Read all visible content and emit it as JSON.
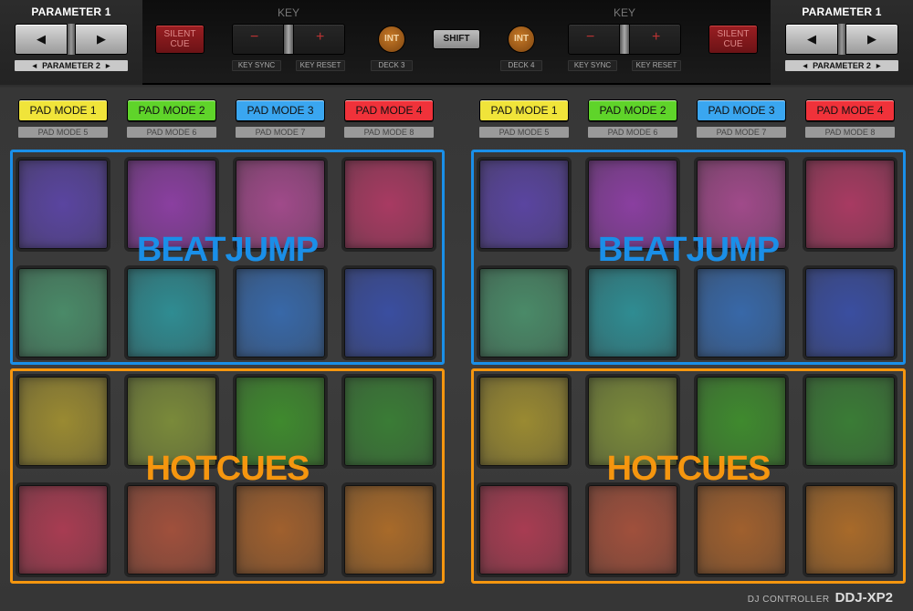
{
  "header": {
    "left_param": {
      "title": "PARAMETER 1",
      "sub_label": "PARAMETER 2",
      "left_arrow": "◀",
      "right_arrow": "▶"
    },
    "right_param": {
      "title": "PARAMETER 1",
      "sub_label": "PARAMETER 2",
      "left_arrow": "◀",
      "right_arrow": "▶"
    },
    "left_deck": {
      "silent_cue": "SILENT CUE",
      "key_title": "KEY",
      "minus": "−",
      "plus": "+",
      "key_sync": "KEY SYNC",
      "key_reset": "KEY RESET",
      "int_label": "INT",
      "deck_label": "DECK 3"
    },
    "shift_label": "SHIFT",
    "right_deck": {
      "int_label": "INT",
      "deck_label": "DECK 4",
      "key_title": "KEY",
      "minus": "−",
      "plus": "+",
      "key_sync": "KEY SYNC",
      "key_reset": "KEY RESET",
      "silent_cue": "SILENT CUE"
    }
  },
  "pad_modes": {
    "left": [
      {
        "label": "PAD MODE 1",
        "sub": "PAD MODE 5",
        "color": "#f0e43a"
      },
      {
        "label": "PAD MODE 2",
        "sub": "PAD MODE 6",
        "color": "#5fd42a"
      },
      {
        "label": "PAD MODE 3",
        "sub": "PAD MODE 7",
        "color": "#3aa6f0"
      },
      {
        "label": "PAD MODE 4",
        "sub": "PAD MODE 8",
        "color": "#f0323a"
      }
    ],
    "right": [
      {
        "label": "PAD MODE 1",
        "sub": "PAD MODE 5",
        "color": "#f0e43a"
      },
      {
        "label": "PAD MODE 2",
        "sub": "PAD MODE 6",
        "color": "#5fd42a"
      },
      {
        "label": "PAD MODE 3",
        "sub": "PAD MODE 7",
        "color": "#3aa6f0"
      },
      {
        "label": "PAD MODE 4",
        "sub": "PAD MODE 8",
        "color": "#f0323a"
      }
    ]
  },
  "zones": {
    "top": {
      "label": "BEATJUMP",
      "color": "#1a8fe8"
    },
    "bottom": {
      "label": "HOTCUES",
      "color": "#f5960f"
    }
  },
  "pad_colors": [
    "#5a45a0",
    "#8a3fa0",
    "#a04a8a",
    "#a83a62",
    "#4a8a68",
    "#2f8c92",
    "#3868a8",
    "#3a4ea0",
    "#9a8a32",
    "#7a8a3a",
    "#3f8a2e",
    "#3a7c36",
    "#a83c52",
    "#a0503c",
    "#a0602e",
    "#a86a2a"
  ],
  "footer": {
    "model_prefix": "DJ CONTROLLER",
    "model": "DDJ-XP2"
  }
}
